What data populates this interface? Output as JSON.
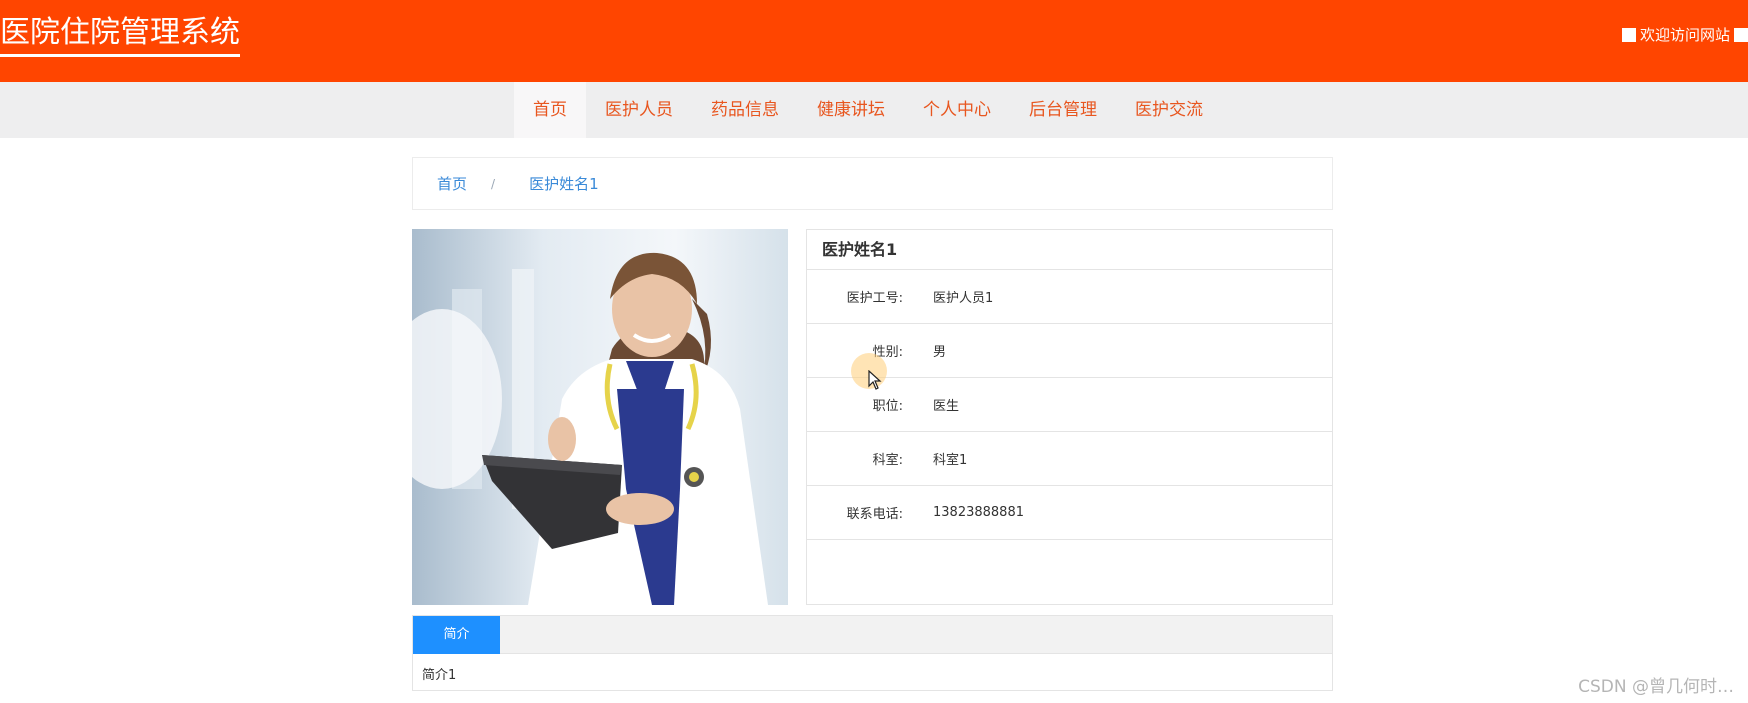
{
  "header": {
    "site_title": "医院住院管理系统",
    "welcome": "欢迎访问网站"
  },
  "nav": {
    "items": [
      {
        "label": "首页"
      },
      {
        "label": "医护人员"
      },
      {
        "label": "药品信息"
      },
      {
        "label": "健康讲坛"
      },
      {
        "label": "个人中心"
      },
      {
        "label": "后台管理"
      },
      {
        "label": "医护交流"
      }
    ]
  },
  "breadcrumb": {
    "home": "首页",
    "separator": "/",
    "current": "医护姓名1"
  },
  "detail": {
    "name": "医护姓名1",
    "fields": [
      {
        "label": "医护工号:",
        "value": "医护人员1"
      },
      {
        "label": "性别:",
        "value": "男"
      },
      {
        "label": "职位:",
        "value": "医生"
      },
      {
        "label": "科室:",
        "value": "科室1"
      },
      {
        "label": "联系电话:",
        "value": "13823888881"
      }
    ]
  },
  "tabs": {
    "active_label": "简介",
    "content": "简介1"
  },
  "watermark": "CSDN @曾几何时…",
  "colors": {
    "header_bg": "#ff4500",
    "nav_text": "#e8561f",
    "link_blue": "#3a8ad8",
    "tab_blue": "#1e90ff"
  }
}
